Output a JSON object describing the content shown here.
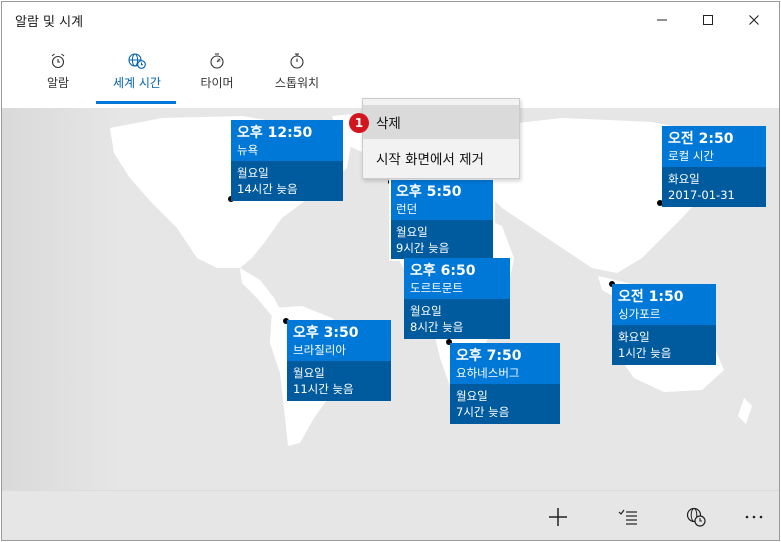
{
  "window": {
    "title": "알람 및 시계"
  },
  "tabs": [
    {
      "label": "알람",
      "icon": "alarm-clock-icon"
    },
    {
      "label": "세계 시간",
      "icon": "world-clock-icon",
      "active": true
    },
    {
      "label": "타이머",
      "icon": "timer-icon"
    },
    {
      "label": "스톱워치",
      "icon": "stopwatch-icon"
    }
  ],
  "context_menu": {
    "badge": "1",
    "items": [
      "삭제",
      "시작 화면에서 제거"
    ]
  },
  "clocks": [
    {
      "time": "오후 12:50",
      "city": "뉴욕",
      "day": "월요일",
      "diff": "14시간 늦음"
    },
    {
      "time": "오후 5:50",
      "city": "런던",
      "day": "월요일",
      "diff": "9시간 늦음"
    },
    {
      "time": "오후 6:50",
      "city": "도르트문트",
      "day": "월요일",
      "diff": "8시간 늦음"
    },
    {
      "time": "오후 3:50",
      "city": "브라질리아",
      "day": "월요일",
      "diff": "11시간 늦음"
    },
    {
      "time": "오후 7:50",
      "city": "요하네스버그",
      "day": "월요일",
      "diff": "7시간 늦음"
    },
    {
      "time": "오전 2:50",
      "city": "로컬 시간",
      "day": "화요일",
      "diff": "2017-01-31"
    },
    {
      "time": "오전 1:50",
      "city": "싱가포르",
      "day": "화요일",
      "diff": "1시간 늦음"
    }
  ],
  "bottom_bar": {
    "buttons": [
      "add-icon",
      "select-list-icon",
      "compare-time-icon",
      "more-icon"
    ]
  },
  "colors": {
    "accent": "#0078d7",
    "card_bottom": "#005a9e",
    "map_bg": "#e6e6e6",
    "land": "#ffffff",
    "badge": "#d2161f"
  }
}
